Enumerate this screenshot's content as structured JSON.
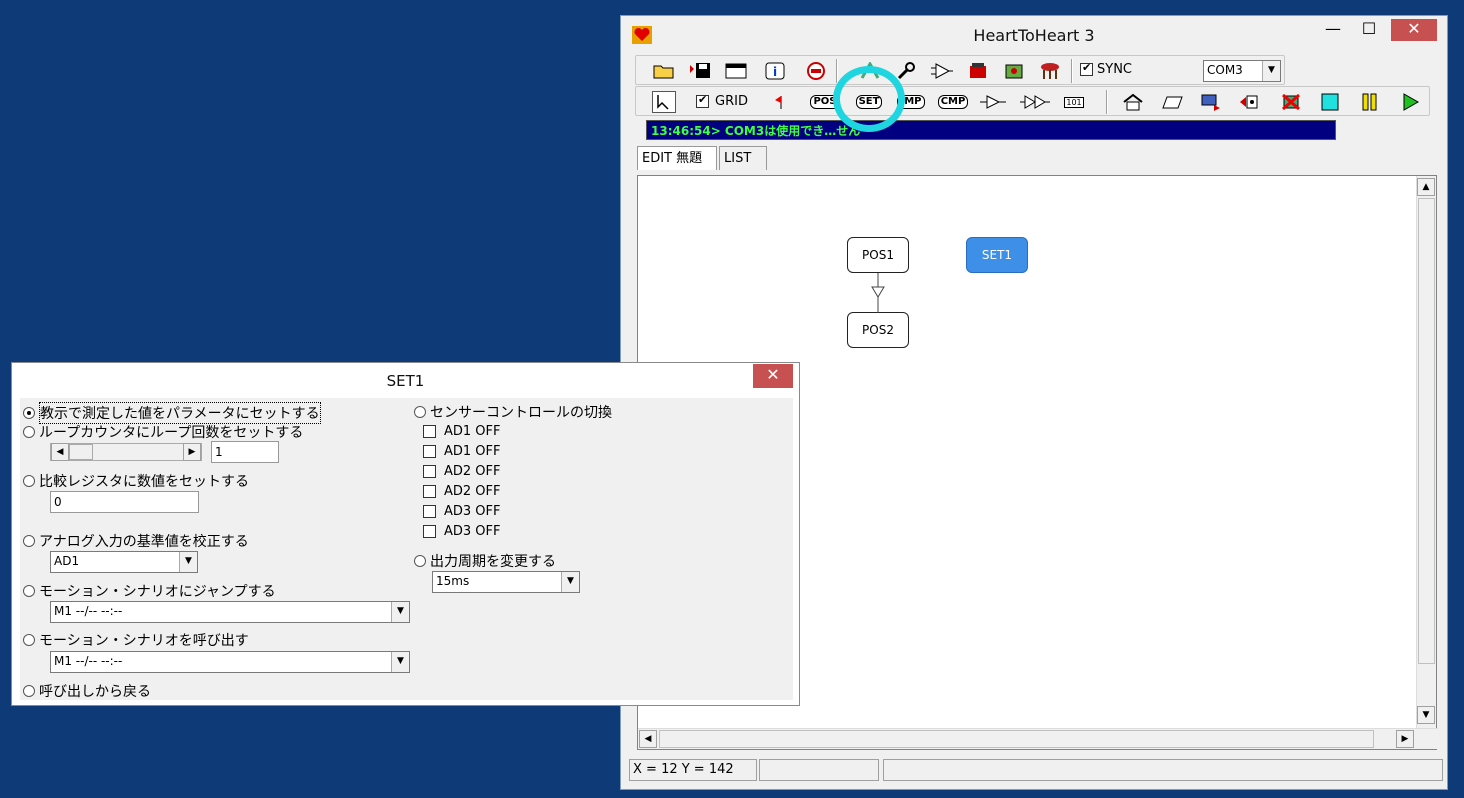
{
  "window": {
    "title": "HeartToHeart 3",
    "min_glyph": "—",
    "max_glyph": "☐",
    "close_glyph": "✕"
  },
  "toolbar1": {
    "icons": [
      "open-folder-icon",
      "save-icon",
      "window-icon",
      "info-icon",
      "stop-icon",
      "robot-icon",
      "wrench-icon",
      "servo-icon",
      "device-icon",
      "board-icon",
      "stool-icon"
    ],
    "sync_label": "SYNC",
    "sync_checked": true,
    "port_value": "COM3"
  },
  "toolbar2": {
    "grid_label": "GRID",
    "grid_checked": true,
    "pos_label": "POS",
    "set_label": "SET",
    "jmp_label": "JMP",
    "cmp_label": "CMP",
    "counter_label": "101"
  },
  "message": "13:46:54> COM3は使用でき…せん",
  "tabs": [
    "EDIT 無題",
    "LIST"
  ],
  "nodes": {
    "pos1": "POS1",
    "set1": "SET1",
    "pos2": "POS2"
  },
  "status": {
    "coords": "X = 12  Y = 142"
  },
  "dialog": {
    "title": "SET1",
    "close_glyph": "✕",
    "options": {
      "teach": "教示で測定した値をパラメータにセットする",
      "loop": "ループカウンタにループ回数をセットする",
      "loop_value": "1",
      "compare": "比較レジスタに数値をセットする",
      "compare_value": "0",
      "analog": "アナログ入力の基準値を校正する",
      "analog_value": "AD1",
      "jump": "モーション・シナリオにジャンプする",
      "jump_value": "M1  --/-- --:--",
      "call": "モーション・シナリオを呼び出す",
      "call_value": "M1  --/-- --:--",
      "return": "呼び出しから戻る",
      "sensor": "センサーコントロールの切換",
      "sensor_items": [
        "AD1 OFF",
        "AD1 OFF",
        "AD2 OFF",
        "AD2 OFF",
        "AD3 OFF",
        "AD3 OFF"
      ],
      "period": "出力周期を変更する",
      "period_value": "15ms"
    },
    "selected_option": "teach"
  }
}
